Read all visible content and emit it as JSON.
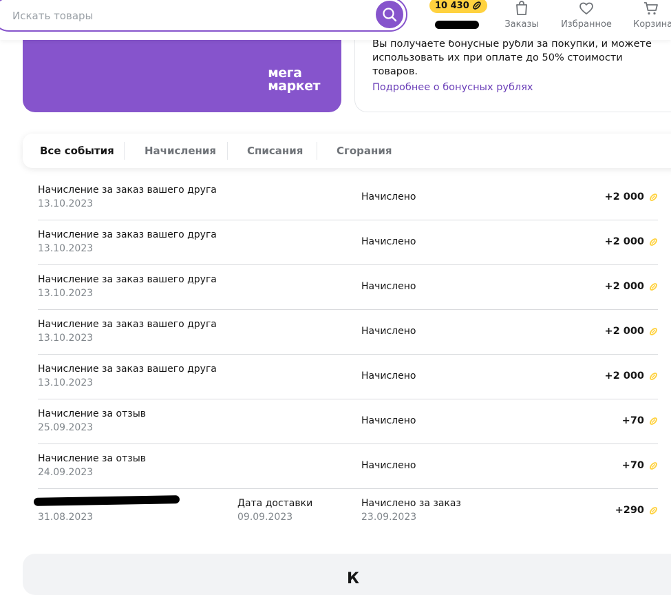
{
  "header": {
    "search_placeholder": "Искать товары",
    "bonus_balance": "10 430",
    "nav": {
      "orders_label": "Заказы",
      "favorites_label": "Избранное",
      "cart_label": "Корзина"
    }
  },
  "banner": {
    "logo_line1": "мега",
    "logo_line2": "маркет"
  },
  "info": {
    "text": "Вы получаете бонусные рубли за покупки, и можете использовать их при оплате до 50% стоимости товаров.",
    "link": "Подробнее о бонусных рублях"
  },
  "tabs": [
    {
      "label": "Все события",
      "active": true
    },
    {
      "label": "Начисления",
      "active": false
    },
    {
      "label": "Списания",
      "active": false
    },
    {
      "label": "Сгорания",
      "active": false
    }
  ],
  "events": [
    {
      "title": "Начисление за заказ вашего друга",
      "date": "13.10.2023",
      "status": "Начислено",
      "amount": "+2 000"
    },
    {
      "title": "Начисление за заказ вашего друга",
      "date": "13.10.2023",
      "status": "Начислено",
      "amount": "+2 000"
    },
    {
      "title": "Начисление за заказ вашего друга",
      "date": "13.10.2023",
      "status": "Начислено",
      "amount": "+2 000"
    },
    {
      "title": "Начисление за заказ вашего друга",
      "date": "13.10.2023",
      "status": "Начислено",
      "amount": "+2 000"
    },
    {
      "title": "Начисление за заказ вашего друга",
      "date": "13.10.2023",
      "status": "Начислено",
      "amount": "+2 000"
    },
    {
      "title": "Начисление за отзыв",
      "date": "25.09.2023",
      "status": "Начислено",
      "amount": "+70"
    },
    {
      "title": "Начисление за отзыв",
      "date": "24.09.2023",
      "status": "Начислено",
      "amount": "+70"
    }
  ],
  "order_event": {
    "date": "31.08.2023",
    "delivery_label": "Дата доставки",
    "delivery_date": "09.09.2023",
    "status": "Начислено за заказ",
    "status_date": "23.09.2023",
    "amount": "+290"
  },
  "bottom": {
    "title": "К"
  },
  "colors": {
    "brand_purple": "#8654cc",
    "bonus_yellow": "#ffd23f",
    "link_purple": "#6b3fb8"
  }
}
